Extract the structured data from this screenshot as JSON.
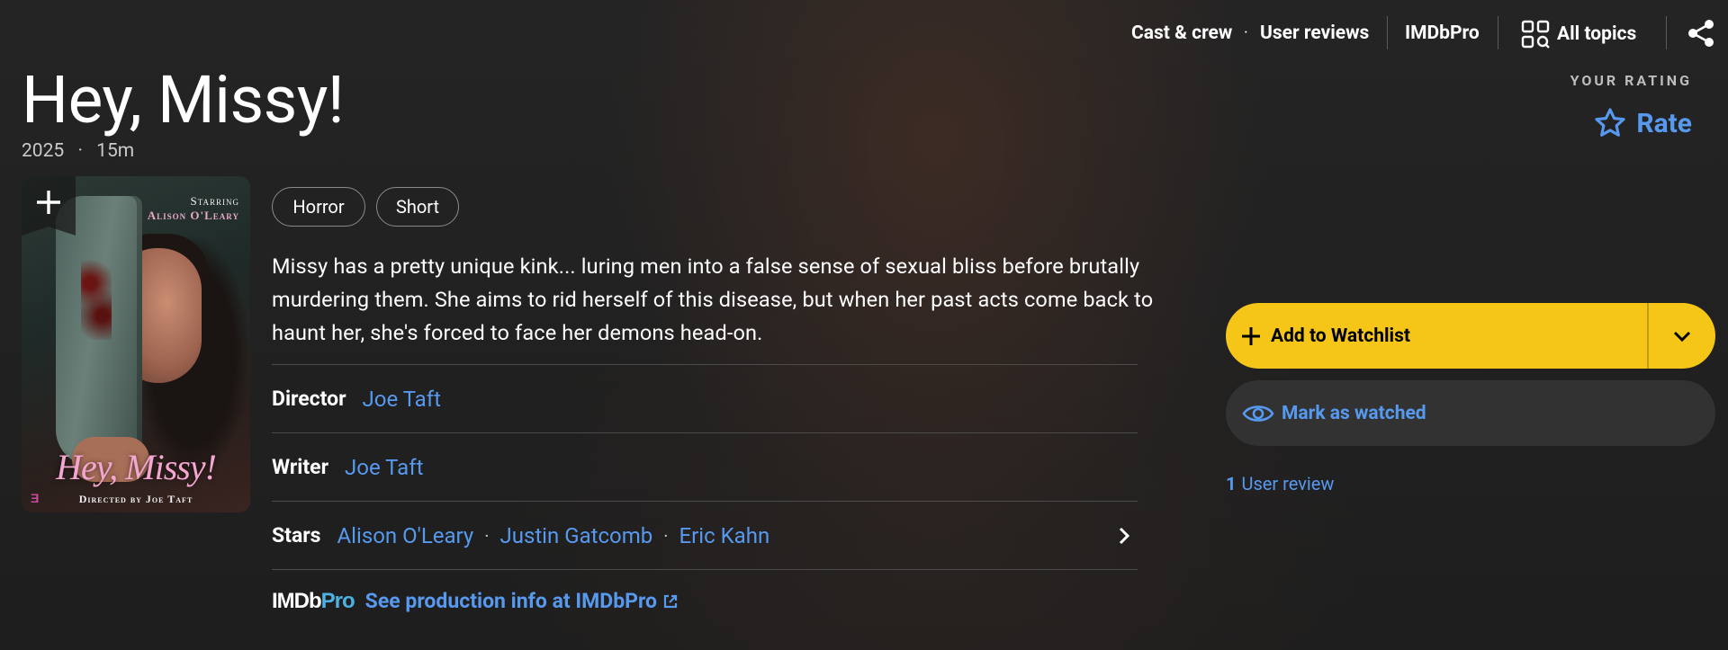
{
  "nav": {
    "cast_crew": "Cast & crew",
    "user_reviews": "User reviews",
    "imdbpro": "IMDbPro",
    "all_topics": "All topics",
    "dot": "·"
  },
  "title": {
    "name": "Hey, Missy!",
    "year": "2025",
    "runtime": "15m",
    "dot": "·"
  },
  "rating": {
    "your_rating_label": "YOUR RATING",
    "rate_label": "Rate"
  },
  "poster": {
    "starring": "Starring",
    "actor": "Alison O'Leary",
    "title": "Hey, Missy!",
    "directed_by": "Directed by Joe Taft"
  },
  "genres": [
    "Horror",
    "Short"
  ],
  "plot": "Missy has a pretty unique kink... luring men into a false sense of sexual bliss before brutally murdering them. She aims to rid herself of this disease, but when her past acts come back to haunt her, she's forced to face her demons head-on.",
  "credits": {
    "director": {
      "label": "Director",
      "names": [
        "Joe Taft"
      ]
    },
    "writer": {
      "label": "Writer",
      "names": [
        "Joe Taft"
      ]
    },
    "stars": {
      "label": "Stars",
      "names": [
        "Alison O'Leary",
        "Justin Gatcomb",
        "Eric Kahn"
      ]
    },
    "sep": "·"
  },
  "pro": {
    "logo_imdb": "IMDb",
    "logo_pro": "Pro",
    "link": "See production info at IMDbPro"
  },
  "watchlist": {
    "add_label": "Add to Watchlist",
    "mark_watched_label": "Mark as watched"
  },
  "reviews": {
    "count": "1",
    "label": "User review"
  },
  "colors": {
    "accent_blue": "#5799ef",
    "imdb_yellow": "#f5c518",
    "background": "#1f1f1f"
  }
}
